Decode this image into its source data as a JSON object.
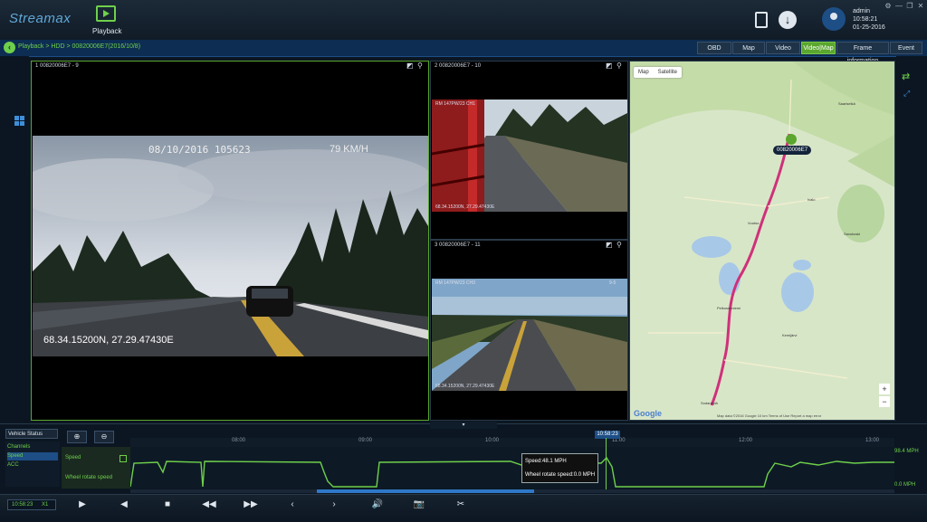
{
  "app": {
    "logo": "Streamax",
    "playback_label": "Playback"
  },
  "user": {
    "name": "admin",
    "time": "10:58:21",
    "date": "01-25-2016"
  },
  "window_controls": [
    "⚙",
    "—",
    "❐",
    "✕"
  ],
  "breadcrumb": "Playback > HDD > 00820006E7(2016/10/8)",
  "tabs": [
    {
      "label": "OBD"
    },
    {
      "label": "Map"
    },
    {
      "label": "Video"
    },
    {
      "label": "Video|Map"
    },
    {
      "label": "Frame information"
    },
    {
      "label": "Event"
    }
  ],
  "videos": {
    "ch1": {
      "title": "1 00820006E7 - 9",
      "timestamp": "08/10/2016 105623",
      "speed": "79 KM/H",
      "gps": "68.34.15200N, 27.29.47430E"
    },
    "ch2": {
      "title": "2 00820006E7 - 10",
      "top_text": "RM 147PW/23 CH1",
      "bottom_text": "68.34.15200N, 27.29.47430E"
    },
    "ch3": {
      "title": "3 00820006E7 - 11",
      "top_text": "RM 147PW/23 CH3",
      "top_right_text": "9-5",
      "bottom_text": "68.34.15200N, 27.29.47430E"
    }
  },
  "map": {
    "type_options": [
      "Map",
      "Satellite"
    ],
    "vehicle_label": "00820006E7",
    "zoom_in": "+",
    "zoom_out": "−",
    "google": "Google",
    "attribution": "Map data ©2016 Google   10 km   Terms of Use   Report a map error",
    "place_labels": [
      "Saariselkä",
      "Ivalo",
      "Vuotso",
      "Sodankylä",
      "Pelkosenniemi",
      "Savukoski",
      "Kemijärvi"
    ]
  },
  "timeline": {
    "vehicle_status": "Vehicle Status",
    "list": [
      "Channels",
      "Speed",
      "ACC"
    ],
    "speed_label": "Speed",
    "wheel_label": "Wheel rotate speed",
    "ticks": [
      "08:00",
      "09:00",
      "10:00",
      "11:00",
      "12:00",
      "13:00"
    ],
    "current_time": "10:58:23",
    "tooltip_speed": "Speed:48.1 MPH",
    "tooltip_wheel": "Wheel rotate speed:0.0 MPH",
    "y_max": "98.4 MPH",
    "y_min": "0.0 MPH",
    "collapse_glyph": "▾"
  },
  "controls": {
    "clock": "10:58:23",
    "speed_mult": "X1",
    "buttons": [
      "▶",
      "◀",
      "■",
      "◀◀",
      "▶▶",
      "‹",
      "›",
      "🔊",
      "📷",
      "✂"
    ]
  },
  "colors": {
    "accent": "#6fd04a",
    "nav": "#0d2d52",
    "route": "#d0307a"
  }
}
